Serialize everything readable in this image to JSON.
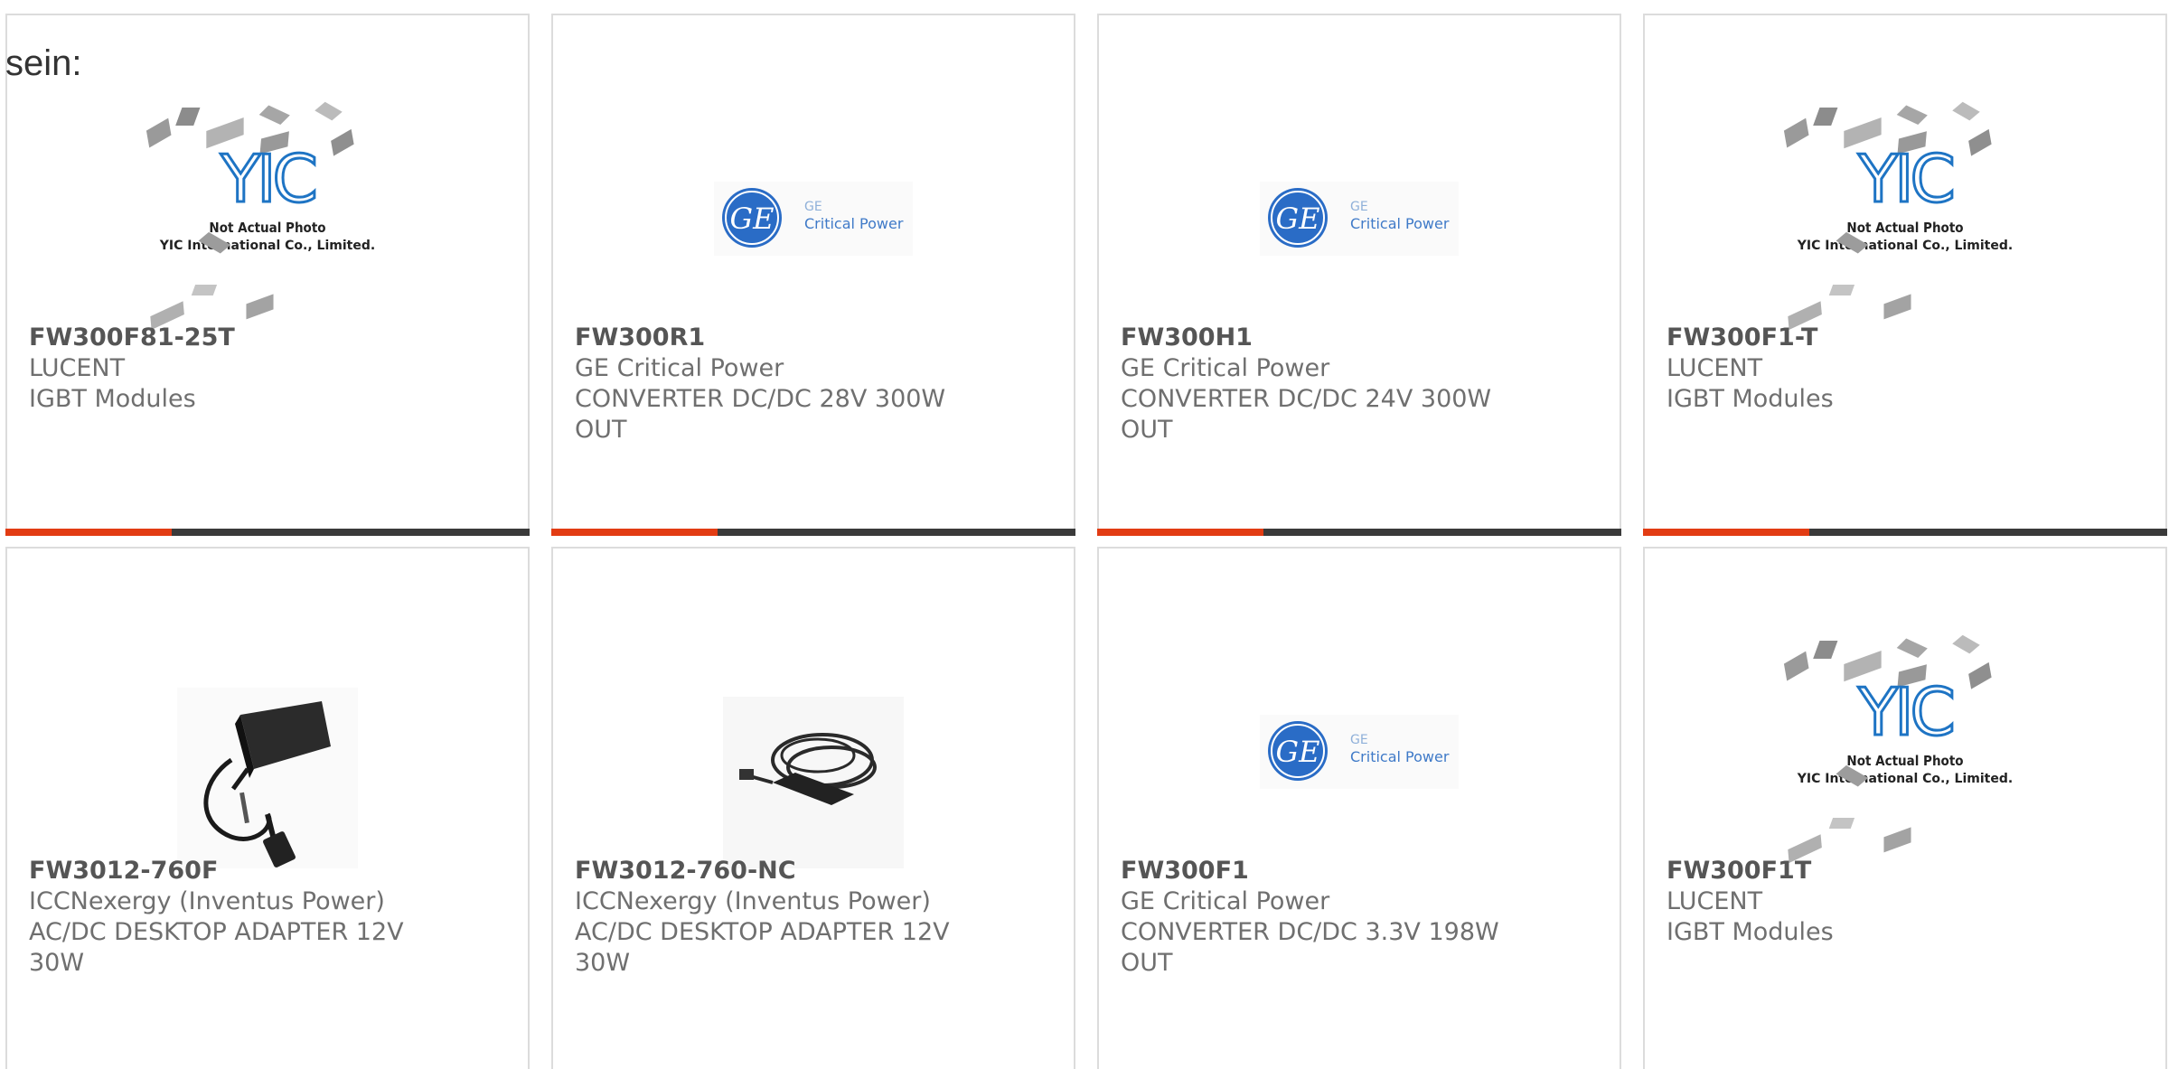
{
  "prefix_text": "sein:",
  "placeholder_caption": [
    "Not Actual Photo",
    "YIC International Co., Limited."
  ],
  "placeholder_logo": "YIC",
  "ge_logo": {
    "letters": "GE",
    "line1": "GE",
    "line2": "Critical Power"
  },
  "accent_colors": {
    "orange": "#e23c13",
    "dark": "#3a3a3a"
  },
  "products": [
    {
      "part": "FW300F81-25T",
      "manufacturer": "LUCENT",
      "description": "IGBT Modules",
      "image": "yic-placeholder"
    },
    {
      "part": "FW300R1",
      "manufacturer": "GE Critical Power",
      "description": "CONVERTER DC/DC 28V 300W OUT",
      "image": "ge-logo"
    },
    {
      "part": "FW300H1",
      "manufacturer": "GE Critical Power",
      "description": "CONVERTER DC/DC 24V 300W OUT",
      "image": "ge-logo"
    },
    {
      "part": "FW300F1-T",
      "manufacturer": "LUCENT",
      "description": "IGBT Modules",
      "image": "yic-placeholder"
    },
    {
      "part": "FW3012-760F",
      "manufacturer": "ICCNexergy (Inventus Power)",
      "description": "AC/DC DESKTOP ADAPTER 12V 30W",
      "image": "adapter-photo"
    },
    {
      "part": "FW3012-760-NC",
      "manufacturer": "ICCNexergy (Inventus Power)",
      "description": "AC/DC DESKTOP ADAPTER 12V 30W",
      "image": "adapter-coiled-photo"
    },
    {
      "part": "FW300F1",
      "manufacturer": "GE Critical Power",
      "description": "CONVERTER DC/DC 3.3V 198W OUT",
      "image": "ge-logo"
    },
    {
      "part": "FW300F1T",
      "manufacturer": "LUCENT",
      "description": "IGBT Modules",
      "image": "yic-placeholder"
    }
  ]
}
